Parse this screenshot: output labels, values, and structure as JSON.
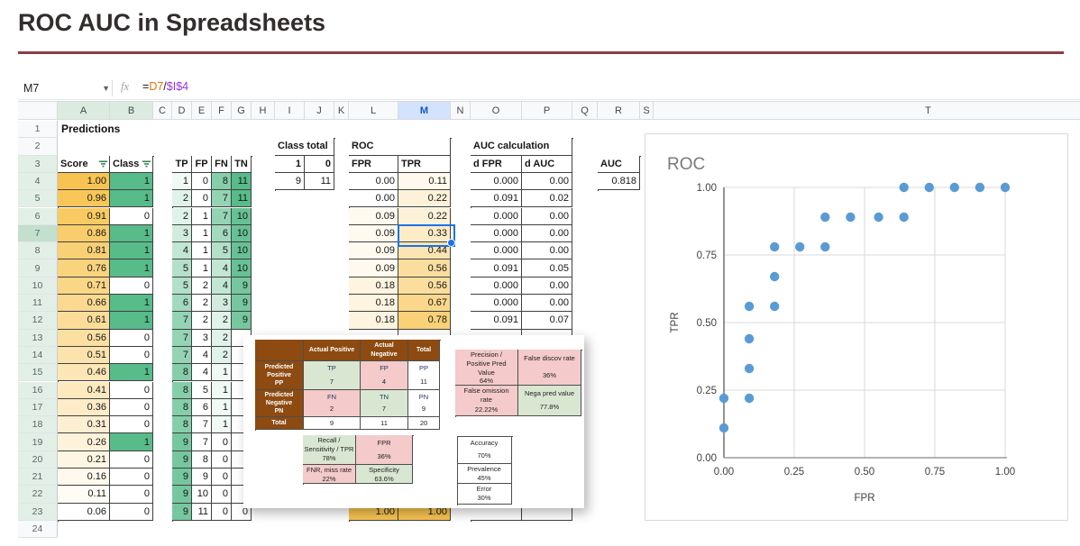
{
  "page": {
    "title": "ROC AUC in Spreadsheets"
  },
  "formula_bar": {
    "cell_ref": "M7",
    "fx_label": "fx",
    "parts": [
      {
        "text": "=",
        "color": "#202124"
      },
      {
        "text": "D7",
        "color": "#e8710a"
      },
      {
        "text": "/",
        "color": "#202124"
      },
      {
        "text": "$I$4",
        "color": "#9334e6"
      }
    ]
  },
  "grid": {
    "columns": [
      "A",
      "B",
      "C",
      "D",
      "E",
      "F",
      "G",
      "H",
      "I",
      "J",
      "K",
      "L",
      "M",
      "N",
      "O",
      "P",
      "Q",
      "R",
      "S",
      "T"
    ],
    "rows": [
      1,
      2,
      3,
      4,
      5,
      6,
      7,
      8,
      9,
      10,
      11,
      12,
      13,
      14,
      15,
      16,
      17,
      18,
      19,
      20,
      21,
      22,
      23,
      24
    ],
    "selected_cell": "M7",
    "selected_column": "M",
    "selected_row": 7,
    "filter_columns": [
      "A",
      "B"
    ],
    "filter_rows_from": 3,
    "filter_rows_to": 23
  },
  "predictions": {
    "title": "Predictions",
    "score_header": "Score",
    "class_header": "Class",
    "rows": [
      {
        "score": "1.00",
        "cls": "1"
      },
      {
        "score": "0.96",
        "cls": "1"
      },
      {
        "score": "0.91",
        "cls": "0"
      },
      {
        "score": "0.86",
        "cls": "1"
      },
      {
        "score": "0.81",
        "cls": "1"
      },
      {
        "score": "0.76",
        "cls": "1"
      },
      {
        "score": "0.71",
        "cls": "0"
      },
      {
        "score": "0.66",
        "cls": "1"
      },
      {
        "score": "0.61",
        "cls": "1"
      },
      {
        "score": "0.56",
        "cls": "0"
      },
      {
        "score": "0.51",
        "cls": "0"
      },
      {
        "score": "0.46",
        "cls": "1"
      },
      {
        "score": "0.41",
        "cls": "0"
      },
      {
        "score": "0.36",
        "cls": "0"
      },
      {
        "score": "0.31",
        "cls": "0"
      },
      {
        "score": "0.26",
        "cls": "1"
      },
      {
        "score": "0.21",
        "cls": "0"
      },
      {
        "score": "0.16",
        "cls": "0"
      },
      {
        "score": "0.11",
        "cls": "0"
      },
      {
        "score": "0.06",
        "cls": "0"
      }
    ]
  },
  "counts_table": {
    "headers": [
      "TP",
      "FP",
      "FN",
      "TN"
    ],
    "rows": [
      [
        1,
        0,
        8,
        11
      ],
      [
        2,
        0,
        7,
        11
      ],
      [
        2,
        1,
        7,
        10
      ],
      [
        3,
        1,
        6,
        10
      ],
      [
        4,
        1,
        5,
        10
      ],
      [
        5,
        1,
        4,
        10
      ],
      [
        5,
        2,
        4,
        9
      ],
      [
        6,
        2,
        3,
        9
      ],
      [
        7,
        2,
        2,
        9
      ],
      [
        7,
        3,
        2,
        null
      ],
      [
        7,
        4,
        2,
        null
      ],
      [
        8,
        4,
        1,
        null
      ],
      [
        8,
        5,
        1,
        null
      ],
      [
        8,
        6,
        1,
        null
      ],
      [
        8,
        7,
        1,
        null
      ],
      [
        9,
        7,
        0,
        null
      ],
      [
        9,
        8,
        0,
        null
      ],
      [
        9,
        9,
        0,
        null
      ],
      [
        9,
        10,
        0,
        null
      ],
      [
        9,
        11,
        0,
        0
      ]
    ]
  },
  "class_total": {
    "title": "Class total",
    "col_headers": [
      "1",
      "0"
    ],
    "values": [
      "9",
      "11"
    ]
  },
  "roc_table": {
    "title": "ROC",
    "headers": [
      "FPR",
      "TPR"
    ],
    "rows": [
      [
        "0.00",
        "0.11"
      ],
      [
        "0.00",
        "0.22"
      ],
      [
        "0.09",
        "0.22"
      ],
      [
        "0.09",
        "0.33"
      ],
      [
        "0.09",
        "0.44"
      ],
      [
        "0.09",
        "0.56"
      ],
      [
        "0.18",
        "0.56"
      ],
      [
        "0.18",
        "0.67"
      ],
      [
        "0.18",
        "0.78"
      ],
      [
        null,
        null
      ],
      [
        null,
        null
      ],
      [
        null,
        null
      ],
      [
        null,
        null
      ],
      [
        null,
        null
      ],
      [
        null,
        null
      ],
      [
        null,
        null
      ],
      [
        null,
        null
      ],
      [
        null,
        null
      ],
      [
        null,
        null
      ],
      [
        "1.00",
        "1.00"
      ]
    ]
  },
  "auc_calc": {
    "title": "AUC calculation",
    "headers": [
      "d FPR",
      "d AUC"
    ],
    "rows": [
      [
        "0.000",
        "0.00"
      ],
      [
        "0.091",
        "0.02"
      ],
      [
        "0.000",
        "0.00"
      ],
      [
        "0.000",
        "0.00"
      ],
      [
        "0.000",
        "0.00"
      ],
      [
        "0.091",
        "0.05"
      ],
      [
        "0.000",
        "0.00"
      ],
      [
        "0.000",
        "0.00"
      ],
      [
        "0.091",
        "0.07"
      ],
      [
        null,
        null
      ],
      [
        null,
        null
      ],
      [
        null,
        null
      ],
      [
        null,
        null
      ],
      [
        null,
        null
      ],
      [
        null,
        null
      ],
      [
        null,
        null
      ],
      [
        null,
        null
      ],
      [
        null,
        null
      ],
      [
        null,
        null
      ],
      [
        null,
        null
      ]
    ]
  },
  "auc_box": {
    "label": "AUC",
    "value": "0.818"
  },
  "confusion_matrix": {
    "col_headers": [
      "Actual Positive",
      "Actual Negative",
      "Total"
    ],
    "rows": [
      {
        "label": "Predicted\nPositive\nPP",
        "cells": [
          {
            "abbr": "TP",
            "value": "7",
            "tone": "good"
          },
          {
            "abbr": "FP",
            "value": "4",
            "tone": "bad"
          },
          {
            "abbr": "PP",
            "value": "11",
            "tone": "plain"
          }
        ]
      },
      {
        "label": "Predicted\nNegative\nPN",
        "cells": [
          {
            "abbr": "FN",
            "value": "2",
            "tone": "bad"
          },
          {
            "abbr": "TN",
            "value": "7",
            "tone": "good"
          },
          {
            "abbr": "PN",
            "value": "9",
            "tone": "plain"
          }
        ]
      },
      {
        "label": "Total",
        "cells": [
          {
            "abbr": "",
            "value": "9",
            "tone": "plain"
          },
          {
            "abbr": "",
            "value": "11",
            "tone": "plain"
          },
          {
            "abbr": "",
            "value": "20",
            "tone": "plain"
          }
        ]
      }
    ]
  },
  "ppv_table": {
    "cells": [
      {
        "label": "Precision /\nPositive Pred\nValue",
        "value": "64%",
        "tone": "bad"
      },
      {
        "label": "False discov rate",
        "value": "36%",
        "tone": "bad"
      },
      {
        "label": "False omission\nrate",
        "value": "22.22%",
        "tone": "bad"
      },
      {
        "label": "Nega pred value",
        "value": "77.8%",
        "tone": "good"
      }
    ]
  },
  "recall_table": {
    "cells": [
      {
        "label": "Recall /\nSensitivity / TPR",
        "value": "78%",
        "tone": "good"
      },
      {
        "label": "FPR",
        "value": "36%",
        "tone": "bad"
      },
      {
        "label": "FNR, miss rate",
        "value": "22%",
        "tone": "bad"
      },
      {
        "label": "Specificity",
        "value": "63.6%",
        "tone": "good"
      }
    ]
  },
  "accuracy_table": {
    "cells": [
      {
        "label": "Accuracy",
        "value": "70%"
      },
      {
        "label": "Prevalence",
        "value": "45%"
      },
      {
        "label": "Error",
        "value": "30%"
      }
    ]
  },
  "chart_data": {
    "type": "scatter",
    "title": "ROC",
    "xlabel": "FPR",
    "ylabel": "TPR",
    "x": [
      0.0,
      0.0,
      0.09,
      0.09,
      0.09,
      0.09,
      0.18,
      0.18,
      0.18,
      0.27,
      0.36,
      0.36,
      0.45,
      0.55,
      0.64,
      0.64,
      0.73,
      0.82,
      0.91,
      1.0
    ],
    "y": [
      0.11,
      0.22,
      0.22,
      0.33,
      0.44,
      0.56,
      0.56,
      0.67,
      0.78,
      0.78,
      0.78,
      0.89,
      0.89,
      0.89,
      0.89,
      1.0,
      1.0,
      1.0,
      1.0,
      1.0
    ],
    "xlim": [
      0,
      1
    ],
    "ylim": [
      0,
      1
    ],
    "xticks": [
      "0.00",
      "0.25",
      "0.50",
      "0.75",
      "1.00"
    ],
    "yticks": [
      "1.00",
      "0.75",
      "0.50",
      "0.25",
      "0.00"
    ],
    "grid": true,
    "legend": false,
    "point_color": "#5b9bd5"
  },
  "colors": {
    "accent_orange": "#f8c451",
    "accent_green": "#57bb8a",
    "selection_blue": "#1a73e8",
    "table_green": "#d9e7d2",
    "table_pink": "#f4caca",
    "table_brown": "#8d4a11",
    "title_rule": "#8e3b45",
    "filter_icon_green": "#2e7d4f"
  }
}
